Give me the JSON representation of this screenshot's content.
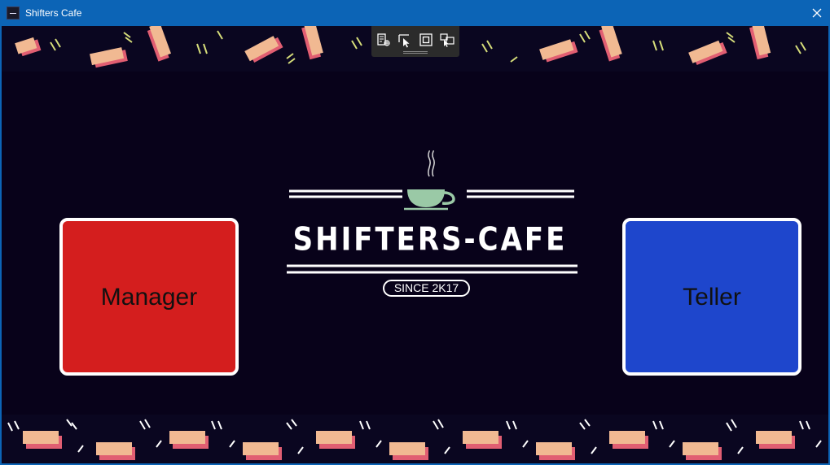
{
  "window": {
    "title": "Shifters Cafe",
    "app_icon": "app-icon",
    "close_icon": "close-icon"
  },
  "toolbar": {
    "icons": [
      "select-element-icon",
      "pointer-icon",
      "display-layout-adorners-icon",
      "track-focused-element-icon"
    ]
  },
  "logo": {
    "title": "SHIFTERS-CAFE",
    "tagline": "SINCE 2K17",
    "icon": "coffee-cup-icon"
  },
  "roles": {
    "manager": "Manager",
    "teller": "Teller"
  },
  "colors": {
    "titlebar": "#0c64b6",
    "background": "#08021a",
    "manager": "#d41e1e",
    "teller": "#1e46cc",
    "cup": "#9ac9a6",
    "ticket": "#f1b992",
    "ticket_shadow": "#e15e72",
    "dash": "#d6dd7a"
  }
}
